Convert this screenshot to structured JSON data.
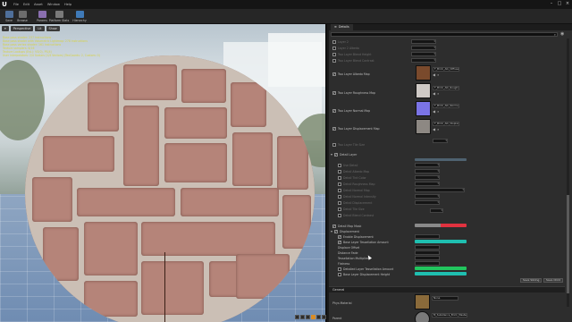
{
  "menubar": {
    "logo": "U",
    "items": [
      "File",
      "Edit",
      "Asset",
      "Window",
      "Help"
    ]
  },
  "toolbar": {
    "buttons": [
      {
        "label": "Save",
        "icon": "save-icon",
        "color": "#4f6f9a"
      },
      {
        "label": "Browse",
        "icon": "browse-icon",
        "color": "#6d6d6d"
      },
      {
        "label": "Params",
        "icon": "params-icon",
        "color": "#8a6fb0"
      },
      {
        "label": "Platform Stats",
        "icon": "stats-icon",
        "color": "#7a7a7a"
      },
      {
        "label": "Hierarchy",
        "icon": "hierarchy-icon",
        "color": "#3f7ab8"
      }
    ]
  },
  "viewport": {
    "perspective_label": "Perspective",
    "lit_label": "Lit",
    "show_label": "Show",
    "stats": [
      "Base pass shader: 237 instructions",
      "Base pass shader with Volumetric Lightmap: 278 instructions",
      "Base pass vertex shader: 161 instructions",
      "Texture samplers: 8/16",
      "Texture Lookups (Est.): VS(0), PS(4)",
      "User interpolators: 2/4 Scalars (1/4 Vectors) (TexCoords: 2, Custom: 0)"
    ]
  },
  "panel": {
    "tab_label": "Details",
    "search_placeholder": "Search",
    "layers": [
      {
        "label": "Two Layer Albedo Map",
        "asset": "T_Brick_Alb_Diffuse",
        "thumb": "#7a4a2c"
      },
      {
        "label": "Two Layer Roughness Map",
        "asset": "T_Brick_Alb_RoughnessMap",
        "thumb": "#cfcac6"
      },
      {
        "label": "Two Layer Normal Map",
        "asset": "T_Brick_Alb_Normal",
        "thumb": "#7b74e6"
      },
      {
        "label": "Two Layer Displacement Map",
        "asset": "T_Brick_Alb_Displacement",
        "thumb": "#8d8883"
      }
    ],
    "top_rows": [
      "Layer 2",
      "Layer 2 Albedo",
      "Two Layer Blend Height",
      "Two Layer Blend Contrast"
    ],
    "last_layer_row": "Two Layer Tile Size",
    "group_header": "Detail Layer",
    "detail_rows": [
      "Use Detail",
      "Detail Albedo Map",
      "Detail Tint Color",
      "Detail Roughness Map",
      "Detail Normal Map",
      "Detail Normal Intensity",
      "Detail Displacement",
      "Detail Tile Size",
      "Detail Blend Contrast"
    ],
    "rows_lower": [
      {
        "label": "Detail Map Mask",
        "checked": true
      },
      {
        "label": "Displacement",
        "checked": true
      },
      {
        "label": "Enable Displacement",
        "checked": true
      },
      {
        "label": "Base Layer Tessellation Amount",
        "checked": true
      },
      {
        "label": "Displace Offset",
        "checked": false
      },
      {
        "label": "Distance Fade",
        "checked": false
      },
      {
        "label": "Tessellation Multiplier",
        "checked": false
      },
      {
        "label": "Flatness",
        "checked": false
      },
      {
        "label": "Detailed Layer Tessellation Amount",
        "checked": false
      },
      {
        "label": "Base Layer Displacement Height",
        "checked": false
      }
    ],
    "general_section": "General",
    "parent_label": "Phys Material",
    "parent_value": "None",
    "parent_material": "Parent",
    "parent_material_value": "M_Substance_Brick_Master",
    "buttons": {
      "save_sibling": "Save Sibling",
      "save_child": "Save Child"
    },
    "colors": {
      "accent_red": "#e0323f",
      "accent_teal": "#1fbfb0",
      "accent_green": "#22c55e"
    }
  }
}
